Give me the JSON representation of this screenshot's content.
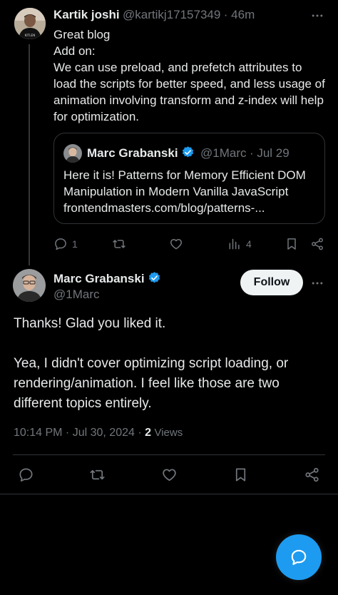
{
  "reply": {
    "author_name": "Kartik joshi",
    "author_handle": "@kartikj17157349",
    "time": "· 46m",
    "text": "Great blog\nAdd on:\nWe can use preload, and prefetch attributes to load the scripts for better speed, and less usage of animation involving transform and z-index will help for optimization.",
    "avatar_badge": "KITLEN",
    "quote": {
      "author_name": "Marc Grabanski",
      "author_handle": "@1Marc",
      "time": "· Jul 29",
      "text": "Here it is! Patterns for Memory Efficient DOM Manipulation in Modern Vanilla JavaScript frontendmasters.com/blog/patterns-..."
    },
    "stats": {
      "replies": "1",
      "views": "4"
    }
  },
  "main_post": {
    "author_name": "Marc Grabanski",
    "author_handle": "@1Marc",
    "follow_label": "Follow",
    "text": "Thanks! Glad you liked it.\n\nYea, I didn't cover optimizing script loading, or rendering/animation. I feel like those are two different topics entirely.",
    "timestamp": "10:14 PM · Jul 30, 2024 ·",
    "views_count": "2",
    "views_label": "Views"
  },
  "colors": {
    "accent": "#1d9bf0",
    "background": "#000000",
    "muted": "#71767b",
    "divider": "#2f3336"
  },
  "icons": [
    "more-icon",
    "verified-badge-icon",
    "reply-icon",
    "repost-icon",
    "like-icon",
    "views-icon",
    "bookmark-icon",
    "share-icon",
    "compose-reply-icon"
  ]
}
